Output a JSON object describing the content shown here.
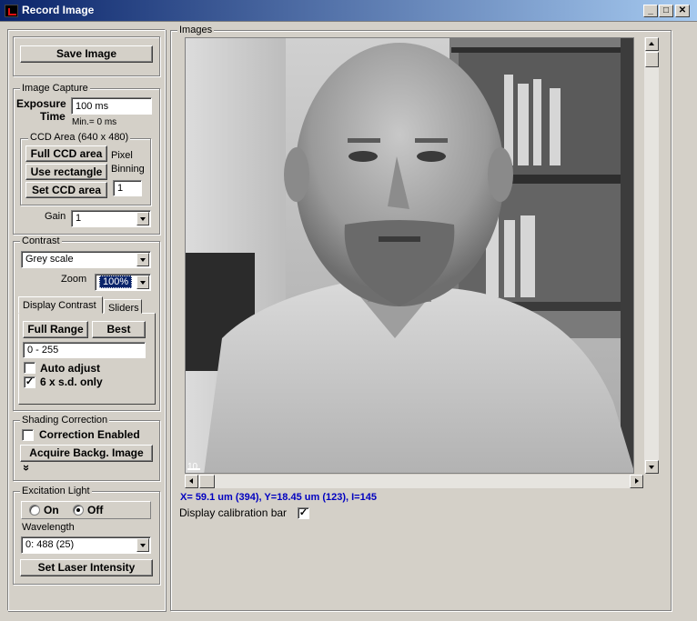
{
  "window": {
    "title": "Record Image"
  },
  "save_image_label": "Save Image",
  "image_capture": {
    "title": "Image Capture",
    "exposure_label_1": "Exposure",
    "exposure_label_2": "Time",
    "exposure_value": "100 ms",
    "min_label": "Min.= 0 ms",
    "ccd_area": {
      "title": "CCD Area (640 x 480)",
      "full_ccd": "Full CCD area",
      "use_rectangle": "Use rectangle",
      "set_ccd": "Set CCD area",
      "pixel_label": "Pixel",
      "binning_label": "Binning",
      "binning_value": "1"
    },
    "gain_label": "Gain",
    "gain_value": "1"
  },
  "contrast": {
    "title": "Contrast",
    "palette_value": "Grey scale",
    "zoom_label": "Zoom",
    "zoom_value": "100%",
    "tabs": [
      "Display Contrast",
      "Sliders"
    ],
    "full_range": "Full Range",
    "best": "Best",
    "range_value": "0 - 255",
    "auto_adjust": "Auto adjust",
    "auto_adjust_checked": false,
    "six_sd": "6 x s.d. only",
    "six_sd_checked": true
  },
  "shading": {
    "title": "Shading Correction",
    "correction_enabled": "Correction Enabled",
    "correction_checked": false,
    "acquire_background": "Acquire Backg. Image",
    "expand_glyph": "»"
  },
  "excitation": {
    "title": "Excitation Light",
    "on_label": "On",
    "off_label": "Off",
    "selected": "Off",
    "wavelength_label": "Wavelength",
    "wavelength_value": "0: 488 (25)",
    "set_laser": "Set Laser Intensity"
  },
  "images": {
    "title": "Images",
    "scale_label": "10",
    "readout": "X= 59.1 um (394), Y=18.45 um (123), I=145",
    "readout_color": "#0000c0",
    "calibration_label": "Display calibration bar",
    "calibration_checked": true,
    "vertical_scroll_position": 0.0,
    "horizontal_scroll_position": 0.0
  },
  "colors": {
    "title_bar_start": "#0a246a",
    "title_bar_end": "#a6caf0",
    "face": "#d4d0c8",
    "zoom_highlight": "#0a246a"
  },
  "icons": {
    "app": "record-image-app-icon",
    "minimize": "minimize-icon",
    "maximize": "maximize-icon",
    "close": "close-icon"
  }
}
